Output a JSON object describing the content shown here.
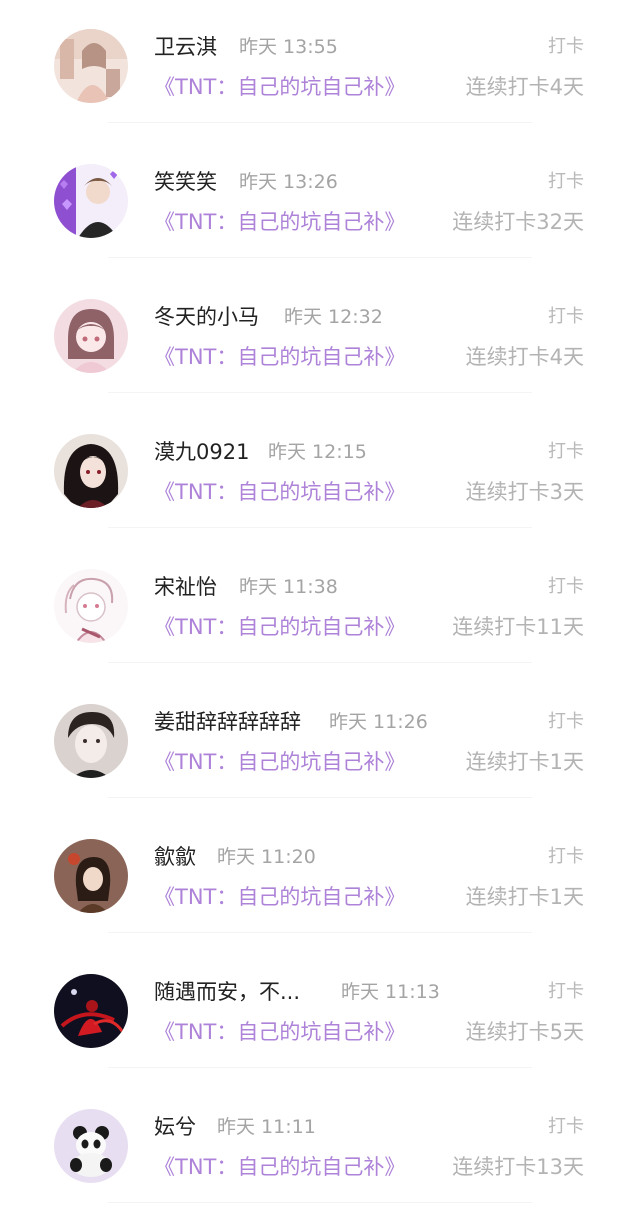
{
  "checkins": [
    {
      "user": "卫云淇",
      "time": "昨天 13:55",
      "action": "打卡",
      "book": "《TNT：自己的坑自己补》",
      "streak": "连续打卡4天",
      "avatar_icon": "avatar-illustration-girl-icon"
    },
    {
      "user": "笑笑笑",
      "time": "昨天 13:26",
      "action": "打卡",
      "book": "《TNT：自己的坑自己补》",
      "streak": "连续打卡32天",
      "avatar_icon": "avatar-photo-boy-purple-hearts-icon"
    },
    {
      "user": "冬天的小马",
      "time": "昨天 12:32",
      "action": "打卡",
      "book": "《TNT：自己的坑自己补》",
      "streak": "连续打卡4天",
      "avatar_icon": "avatar-anime-girl-pink-icon"
    },
    {
      "user": "漠九0921",
      "time": "昨天 12:15",
      "action": "打卡",
      "book": "《TNT：自己的坑自己补》",
      "streak": "连续打卡3天",
      "avatar_icon": "avatar-anime-dark-hair-icon"
    },
    {
      "user": "宋祉怡",
      "time": "昨天 11:38",
      "action": "打卡",
      "book": "《TNT：自己的坑自己补》",
      "streak": "连续打卡11天",
      "avatar_icon": "avatar-sketch-girl-icon"
    },
    {
      "user": "姜甜辞辞辞辞辞",
      "time": "昨天 11:26",
      "action": "打卡",
      "book": "《TNT：自己的坑自己补》",
      "streak": "连续打卡1天",
      "avatar_icon": "avatar-photo-boy-icon"
    },
    {
      "user": "歙歙",
      "time": "昨天 11:20",
      "action": "打卡",
      "book": "《TNT：自己的坑自己补》",
      "streak": "连续打卡1天",
      "avatar_icon": "avatar-cartoon-girl-icon"
    },
    {
      "user": "随遇而安，不...",
      "time": "昨天 11:13",
      "action": "打卡",
      "book": "《TNT：自己的坑自己补》",
      "streak": "连续打卡5天",
      "avatar_icon": "avatar-dark-red-figure-icon"
    },
    {
      "user": "妘兮",
      "time": "昨天 11:11",
      "action": "打卡",
      "book": "《TNT：自己的坑自己补》",
      "streak": "连续打卡13天",
      "avatar_icon": "avatar-panda-toy-icon"
    }
  ],
  "colors": {
    "book_link": "#ad82d8",
    "username": "#222222",
    "time": "#a4a4a4",
    "action": "#b9b9b9",
    "streak": "#b3b3b3"
  }
}
